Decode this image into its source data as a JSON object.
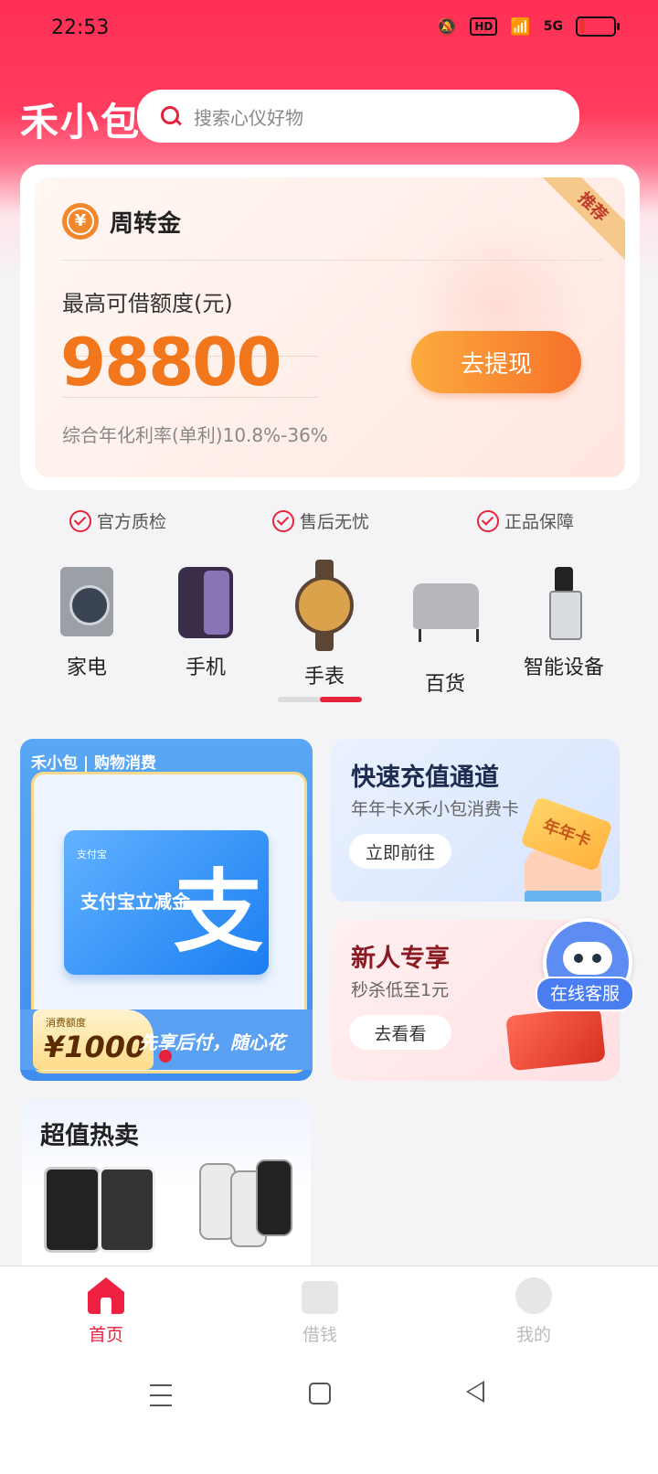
{
  "status_bar": {
    "time": "22:53",
    "hd_badge": "HD",
    "network": "5G"
  },
  "header": {
    "logo": "禾小包",
    "search_placeholder": "搜索心仪好物"
  },
  "main_card": {
    "title": "周转金",
    "coin_glyph": "¥",
    "ribbon": "推荐",
    "limit_label": "最高可借额度(元)",
    "amount": "98800",
    "withdraw_button": "去提现",
    "rate_text": "综合年化利率(单利)10.8%-36%"
  },
  "guarantees": [
    "官方质检",
    "售后无忧",
    "正品保障"
  ],
  "categories": [
    {
      "label": "家电",
      "icon": "washing-machine-icon"
    },
    {
      "label": "手机",
      "icon": "smartphone-icon"
    },
    {
      "label": "手表",
      "icon": "watch-icon"
    },
    {
      "label": "百货",
      "icon": "armchair-icon"
    },
    {
      "label": "智能设备",
      "icon": "vacuum-icon"
    }
  ],
  "category_pager": {
    "pages": 2,
    "active": 2
  },
  "promo_left": {
    "tab": "禾小包 | 购物消费",
    "alipay_small": "支付宝",
    "card_text": "支付宝立减金",
    "card_glyph": "支",
    "quota_label": "消费额度",
    "quota_value": "¥1000",
    "slogan": "先享后付，随心花"
  },
  "promo_topup": {
    "title": "快速充值通道",
    "subtitle": "年年卡X禾小包消费卡",
    "button": "立即前往",
    "ticket_text": "年年卡"
  },
  "promo_newuser": {
    "title": "新人专享",
    "subtitle": "秒杀低至1元",
    "button": "去看看"
  },
  "customer_service": {
    "label": "在线客服"
  },
  "hot_sale": {
    "title": "超值热卖"
  },
  "tabbar": [
    {
      "label": "首页",
      "active": true
    },
    {
      "label": "借钱",
      "active": false
    },
    {
      "label": "我的",
      "active": false
    }
  ],
  "colors": {
    "brand_red": "#e6233d",
    "accent_orange": "#f2761b",
    "inactive_tab": "#bbbbbb"
  }
}
